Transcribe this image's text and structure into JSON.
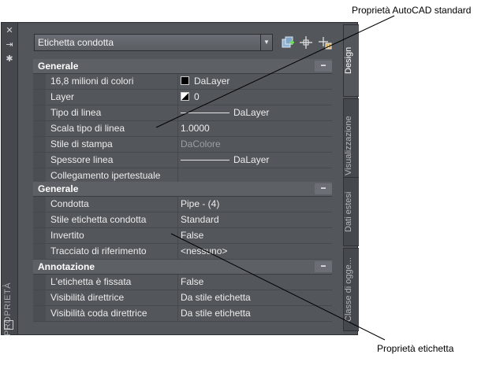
{
  "callouts": {
    "top": "Proprietà AutoCAD standard",
    "bottom": "Proprietà etichetta"
  },
  "titlebar": {
    "title": "PROPRIETÀ",
    "icons": [
      "close-icon",
      "autohide-icon",
      "properties-menu-icon"
    ]
  },
  "toolbar": {
    "selected_object": "Etichetta condotta",
    "buttons": [
      "quick-select-icon",
      "select-objects-icon",
      "pickadd-toggle-icon"
    ]
  },
  "sections": [
    {
      "title": "Generale",
      "toggle": "−",
      "rows": [
        {
          "label": "16,8 milioni di colori",
          "value": "DaLayer",
          "widget": "color-swatch"
        },
        {
          "label": "Layer",
          "value": "0",
          "widget": "layer-icon"
        },
        {
          "label": "Tipo di linea",
          "value": "DaLayer",
          "widget": "line-sample"
        },
        {
          "label": "Scala tipo di linea",
          "value": "1.0000"
        },
        {
          "label": "Stile di stampa",
          "value": "DaColore",
          "dim": true
        },
        {
          "label": "Spessore linea",
          "value": "DaLayer",
          "widget": "line-sample"
        },
        {
          "label": "Collegamento ipertestuale",
          "value": ""
        }
      ]
    },
    {
      "title": "Generale",
      "toggle": "−",
      "rows": [
        {
          "label": "Condotta",
          "value": "Pipe - (4)"
        },
        {
          "label": "Stile etichetta condotta",
          "value": "Standard"
        },
        {
          "label": "Invertito",
          "value": "False"
        },
        {
          "label": "Tracciato di riferimento",
          "value": "<nessuno>"
        }
      ]
    },
    {
      "title": "Annotazione",
      "toggle": "−",
      "rows": [
        {
          "label": "L'etichetta è fissata",
          "value": "False"
        },
        {
          "label": "Visibilità direttrice",
          "value": "Da stile etichetta"
        },
        {
          "label": "Visibilità coda direttrice",
          "value": "Da stile etichetta"
        }
      ]
    }
  ],
  "tabs": [
    {
      "label": "Design",
      "active": true
    },
    {
      "label": "Visualizzazione",
      "active": false
    },
    {
      "label": "Dati estesi",
      "active": false
    },
    {
      "label": "Classe di ogge...",
      "active": false
    }
  ]
}
